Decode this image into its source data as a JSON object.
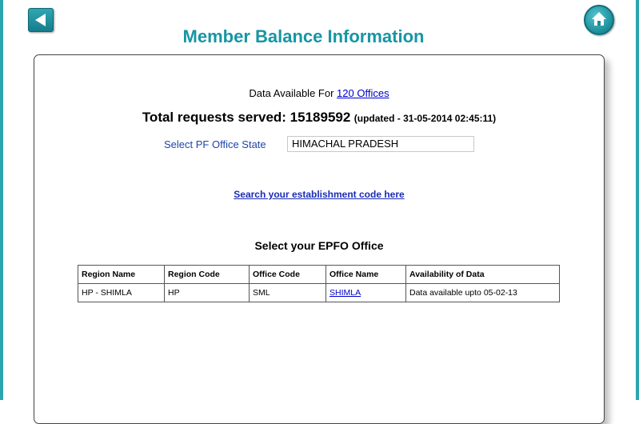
{
  "header": {
    "title": "Member Balance Information"
  },
  "availability": {
    "prefix": "Data Available For",
    "link_text": "120 Offices"
  },
  "stats": {
    "total_label": "Total requests served: 15189592",
    "updated_text": "(updated - 31-05-2014 02:45:11)"
  },
  "state_select": {
    "label": "Select PF Office State",
    "value": "HIMACHAL PRADESH"
  },
  "search_link": "Search your establishment code here",
  "office_section": {
    "title": "Select your EPFO Office",
    "columns": [
      "Region Name",
      "Region Code",
      "Office Code",
      "Office Name",
      "Availability of Data"
    ],
    "rows": [
      [
        "HP - SHIMLA",
        "HP",
        "SML",
        "SHIMLA",
        "Data available upto 05-02-13"
      ]
    ]
  }
}
